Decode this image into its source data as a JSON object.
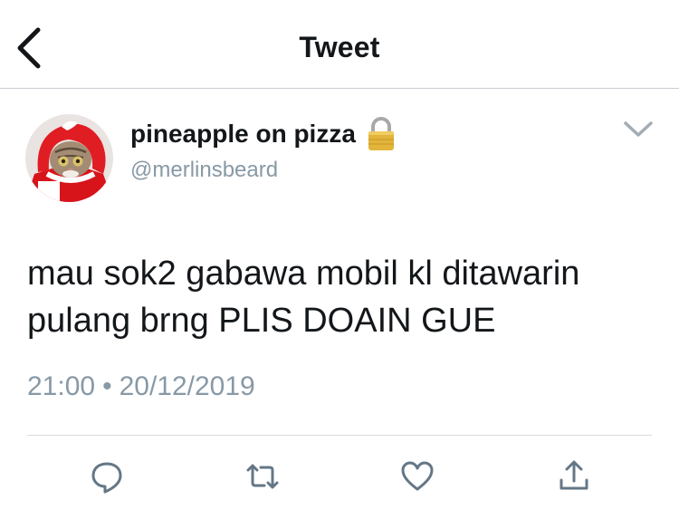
{
  "header": {
    "title": "Tweet",
    "back_icon": "chevron-left-icon"
  },
  "tweet": {
    "author_name": "pineapple on pizza",
    "handle": "@merlinsbeard",
    "protected_icon": "lock-icon",
    "text_line1": "mau sok2 gabawa mobil kl ditawarin",
    "text_line2": "pulang brng PLIS DOAIN GUE",
    "time": "21:00",
    "separator": "•",
    "date": "20/12/2019"
  },
  "actions": [
    "reply-icon",
    "retweet-icon",
    "like-icon",
    "share-icon"
  ],
  "colors": {
    "text": "#14171a",
    "muted": "#8899a6",
    "accent": "#1da1f2",
    "divider": "#d7dbdf"
  }
}
